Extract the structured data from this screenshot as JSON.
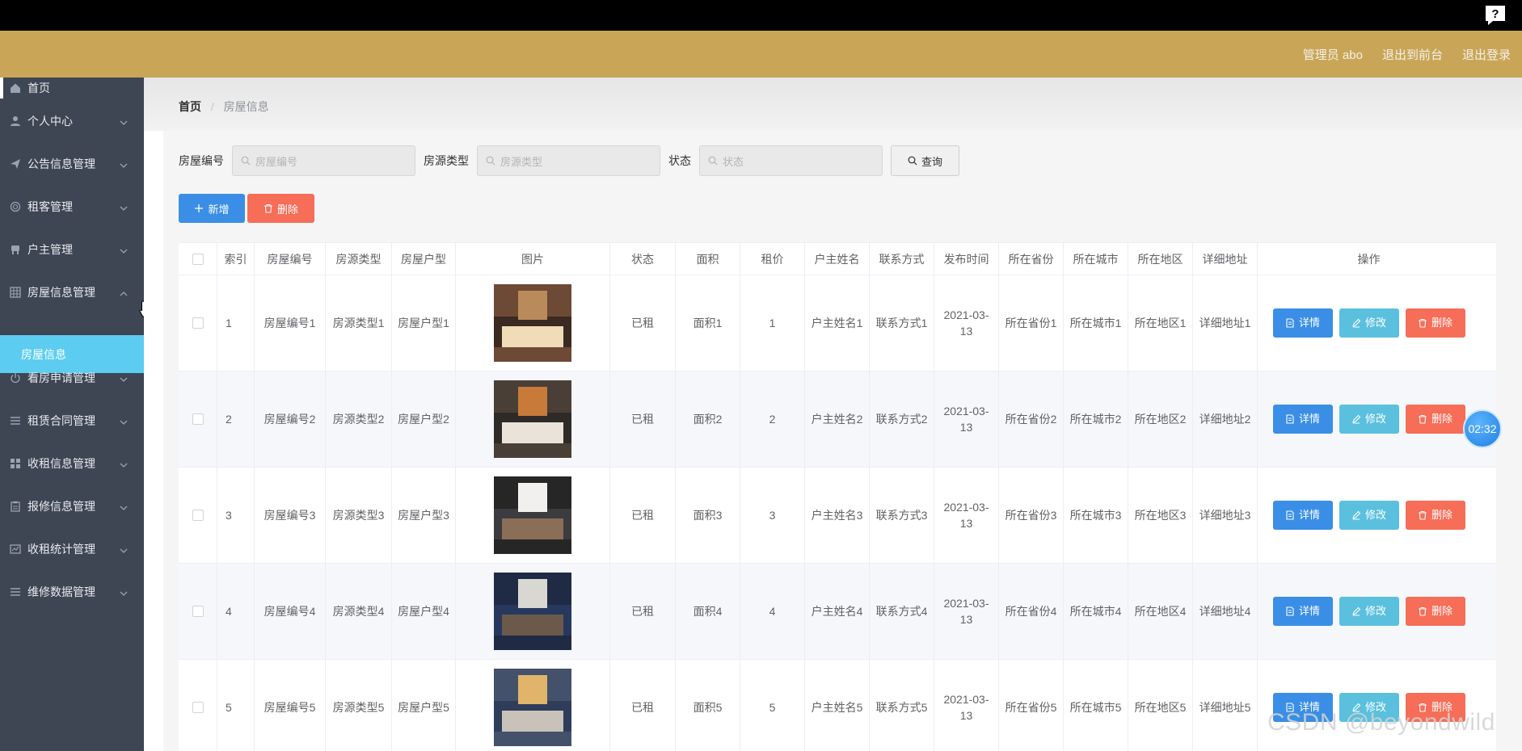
{
  "header": {
    "admin_label": "管理员 abo",
    "back_to_front": "退出到前台",
    "logout": "退出登录"
  },
  "sidebar": {
    "items": [
      {
        "label": "首页",
        "icon": "home-icon"
      },
      {
        "label": "个人中心",
        "icon": "user-icon"
      },
      {
        "label": "公告信息管理",
        "icon": "send-icon"
      },
      {
        "label": "租客管理",
        "icon": "globe-icon"
      },
      {
        "label": "户主管理",
        "icon": "chair-icon"
      },
      {
        "label": "房屋信息管理",
        "icon": "grid-icon"
      },
      {
        "label": "房屋信息",
        "icon": ""
      },
      {
        "label": "看房申请管理",
        "icon": "power-icon"
      },
      {
        "label": "租赁合同管理",
        "icon": "list-icon"
      },
      {
        "label": "收租信息管理",
        "icon": "apps-icon"
      },
      {
        "label": "报修信息管理",
        "icon": "clipboard-icon"
      },
      {
        "label": "收租统计管理",
        "icon": "chart-icon"
      },
      {
        "label": "维修数据管理",
        "icon": "menu-icon"
      }
    ]
  },
  "breadcrumb": {
    "home": "首页",
    "separator": "/",
    "current": "房屋信息"
  },
  "search": {
    "house_no_label": "房屋编号",
    "house_no_placeholder": "房屋编号",
    "source_type_label": "房源类型",
    "source_type_placeholder": "房源类型",
    "status_label": "状态",
    "status_placeholder": "状态",
    "query_button": "查询"
  },
  "actions": {
    "add": "新增",
    "delete": "删除"
  },
  "table": {
    "headers": [
      "",
      "索引",
      "房屋编号",
      "房源类型",
      "房屋户型",
      "图片",
      "状态",
      "面积",
      "租价",
      "户主姓名",
      "联系方式",
      "发布时间",
      "所在省份",
      "所在城市",
      "所在地区",
      "详细地址",
      "操作"
    ],
    "row_buttons": {
      "detail": "详情",
      "edit": "修改",
      "delete": "删除"
    },
    "rows": [
      {
        "index": "1",
        "house_no": "房屋编号1",
        "source_type": "房源类型1",
        "layout": "房屋户型1",
        "status": "已租",
        "area": "面积1",
        "price": "1",
        "owner": "户主姓名1",
        "contact": "联系方式1",
        "published": "2021-03-13",
        "province": "所在省份1",
        "city": "所在城市1",
        "district": "所在地区1",
        "address": "详细地址1"
      },
      {
        "index": "2",
        "house_no": "房屋编号2",
        "source_type": "房源类型2",
        "layout": "房屋户型2",
        "status": "已租",
        "area": "面积2",
        "price": "2",
        "owner": "户主姓名2",
        "contact": "联系方式2",
        "published": "2021-03-13",
        "province": "所在省份2",
        "city": "所在城市2",
        "district": "所在地区2",
        "address": "详细地址2"
      },
      {
        "index": "3",
        "house_no": "房屋编号3",
        "source_type": "房源类型3",
        "layout": "房屋户型3",
        "status": "已租",
        "area": "面积3",
        "price": "3",
        "owner": "户主姓名3",
        "contact": "联系方式3",
        "published": "2021-03-13",
        "province": "所在省份3",
        "city": "所在城市3",
        "district": "所在地区3",
        "address": "详细地址3"
      },
      {
        "index": "4",
        "house_no": "房屋编号4",
        "source_type": "房源类型4",
        "layout": "房屋户型4",
        "status": "已租",
        "area": "面积4",
        "price": "4",
        "owner": "户主姓名4",
        "contact": "联系方式4",
        "published": "2021-03-13",
        "province": "所在省份4",
        "city": "所在城市4",
        "district": "所在地区4",
        "address": "详细地址4"
      },
      {
        "index": "5",
        "house_no": "房屋编号5",
        "source_type": "房源类型5",
        "layout": "房屋户型5",
        "status": "已租",
        "area": "面积5",
        "price": "5",
        "owner": "户主姓名5",
        "contact": "联系方式5",
        "published": "2021-03-13",
        "province": "所在省份5",
        "city": "所在城市5",
        "district": "所在地区5",
        "address": "详细地址5"
      }
    ]
  },
  "overlay": {
    "timer": "02:32",
    "watermark": "CSDN @beyondwild"
  },
  "colors": {
    "header": "#c9a657",
    "sidebar": "#3e4553",
    "active_submenu": "#5ccdf0",
    "primary": "#3a8ee6",
    "info": "#5bc0de",
    "danger": "#f66d58"
  }
}
